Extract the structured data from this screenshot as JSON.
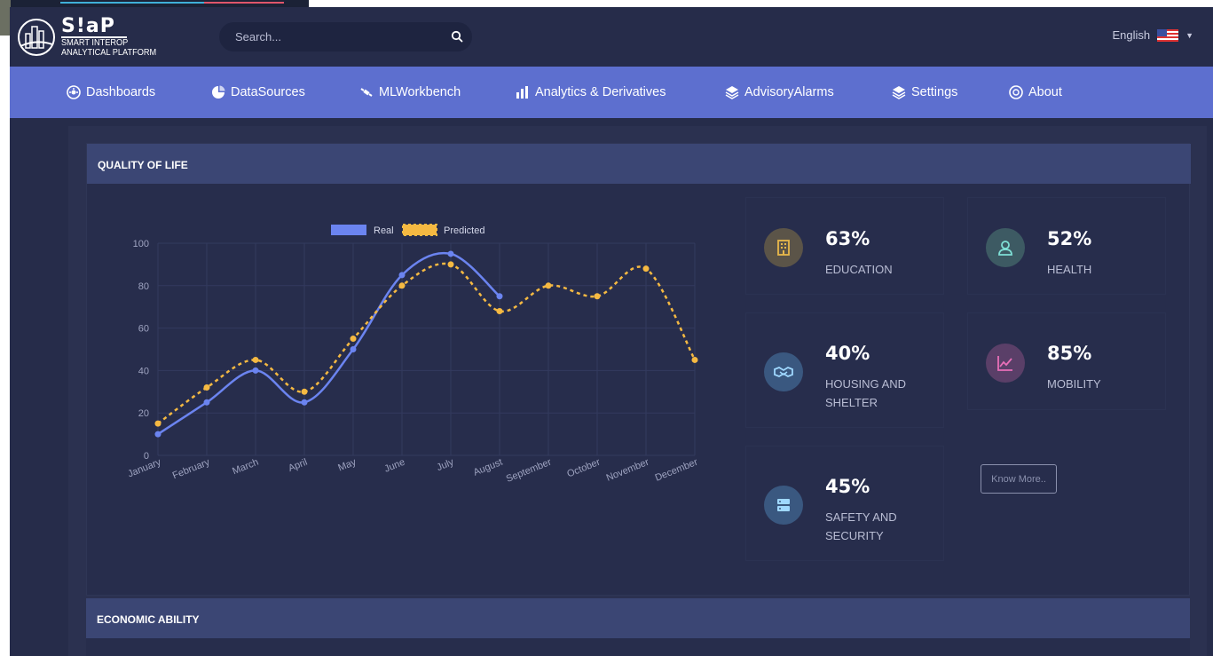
{
  "app": {
    "logo_title": "S!aP",
    "logo_line1": "SMART INTEROP",
    "logo_line2": "ANALYTICAL PLATFORM"
  },
  "search": {
    "placeholder": "Search..."
  },
  "language": {
    "label": "English"
  },
  "nav": [
    {
      "label": "Dashboards",
      "icon": "dashboard-icon"
    },
    {
      "label": "DataSources",
      "icon": "pie-chart-icon"
    },
    {
      "label": "MLWorkbench",
      "icon": "satellite-icon"
    },
    {
      "label": "Analytics & Derivatives",
      "icon": "bar-chart-icon"
    },
    {
      "label": "AdvisoryAlarms",
      "icon": "layers-icon"
    },
    {
      "label": "Settings",
      "icon": "layers-icon"
    },
    {
      "label": "About",
      "icon": "info-circle-icon"
    }
  ],
  "sections": {
    "quality_of_life": "QUALITY OF LIFE",
    "economic_ability": "ECONOMIC ABILITY"
  },
  "tiles": [
    {
      "value": "63%",
      "label": "EDUCATION",
      "icon": "building-icon",
      "color": "#e8b84b",
      "bg": "#5b5448"
    },
    {
      "value": "52%",
      "label": "HEALTH",
      "icon": "user-icon",
      "color": "#7fe0d6",
      "bg": "#3d5a63"
    },
    {
      "value": "40%",
      "label": "HOUSING AND SHELTER",
      "icon": "handshake-icon",
      "color": "#9fd8ff",
      "bg": "#3a5880"
    },
    {
      "value": "85%",
      "label": "MOBILITY",
      "icon": "trend-chart-icon",
      "color": "#e86fb8",
      "bg": "#5a3f68"
    },
    {
      "value": "45%",
      "label": "SAFETY AND SECURITY",
      "icon": "server-icon",
      "color": "#9fd8ff",
      "bg": "#3a5880"
    }
  ],
  "know_more": "Know More..",
  "chart_data": {
    "type": "line",
    "categories": [
      "January",
      "February",
      "March",
      "April",
      "May",
      "June",
      "July",
      "August",
      "September",
      "October",
      "November",
      "December"
    ],
    "series": [
      {
        "name": "Real",
        "values": [
          10,
          25,
          40,
          25,
          50,
          85,
          95,
          75,
          null,
          null,
          null,
          null
        ],
        "color": "#6b84f0",
        "style": "solid"
      },
      {
        "name": "Predicted",
        "values": [
          15,
          32,
          45,
          30,
          55,
          80,
          90,
          68,
          80,
          75,
          88,
          45
        ],
        "color": "#f5b942",
        "style": "dashed"
      }
    ],
    "yticks": [
      0,
      20,
      40,
      60,
      80,
      100
    ],
    "ylim": [
      0,
      100
    ],
    "legend_position": "top",
    "grid": true
  },
  "colors": {
    "nav_bg": "#5d6fcf",
    "page_bg": "#262c4a",
    "section_header": "#3b4674"
  }
}
